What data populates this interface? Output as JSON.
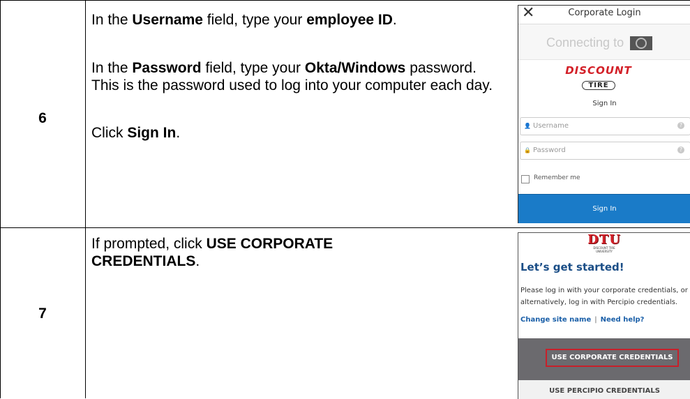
{
  "rows": [
    {
      "step": "6",
      "lines": {
        "l1_a": "In the ",
        "l1_b": "Username",
        "l1_c": " field, type your ",
        "l1_d": "employee ID",
        "l1_e": ".",
        "l2_a": "In the ",
        "l2_b": "Password",
        "l2_c": " field, type your ",
        "l2_d": "Okta/Windows",
        "l2_e": " password. This is the password used to log into your computer each day.",
        "l3_a": "Click ",
        "l3_b": "Sign In",
        "l3_c": "."
      },
      "screenshot": {
        "close_glyph": "✕",
        "title": "Corporate Login",
        "connecting": "Connecting to",
        "logo_main": "DISCOUNT",
        "logo_sub": "TIRE",
        "signin_heading": "Sign In",
        "username_placeholder": "Username",
        "password_placeholder": "Password",
        "remember_label": "Remember me",
        "signin_button": "Sign In",
        "help_glyph": "?",
        "user_icon_glyph": "👤",
        "lock_icon_glyph": "🔒"
      }
    },
    {
      "step": "7",
      "lines": {
        "l1_a": "If prompted, click ",
        "l1_b": "USE CORPORATE CREDENTIALS",
        "l1_c": "."
      },
      "screenshot": {
        "logo_main": "DTU",
        "logo_sub": "DISCOUNT TIRE UNIVERSITY",
        "title": "Let’s get started!",
        "body": "Please log in with your corporate credentials, or alternatively, log in with Percipio credentials.",
        "link_change": "Change site name",
        "link_sep": "|",
        "link_help": "Need help?",
        "corp_button": "USE CORPORATE CREDENTIALS",
        "percipio_button": "USE PERCIPIO CREDENTIALS"
      }
    }
  ],
  "colors": {
    "signin_blue": "#1a7bc8",
    "brand_red": "#d32028",
    "title_blue": "#1a4d86",
    "highlight_red": "#c8202a",
    "grey_band": "#6b6a6e"
  }
}
